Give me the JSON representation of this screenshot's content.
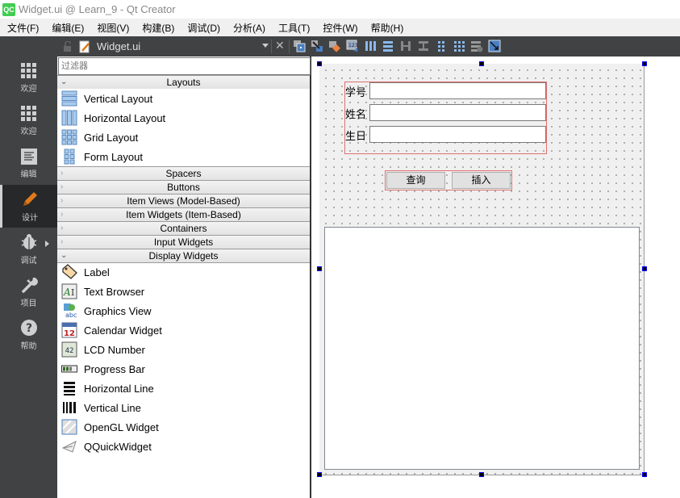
{
  "window": {
    "logo": "QC",
    "title": "Widget.ui @ Learn_9 - Qt Creator"
  },
  "menu": [
    "文件(F)",
    "编辑(E)",
    "视图(V)",
    "构建(B)",
    "调试(D)",
    "分析(A)",
    "工具(T)",
    "控件(W)",
    "帮助(H)"
  ],
  "toolbar": {
    "document": "Widget.ui",
    "close_glyph": "✕"
  },
  "modes": [
    {
      "label": "欢迎",
      "icon": "grid-icon"
    },
    {
      "label": "欢迎",
      "icon": "grid-icon"
    },
    {
      "label": "编辑",
      "icon": "edit-document-icon"
    },
    {
      "label": "设计",
      "icon": "pencil-icon",
      "active": true
    },
    {
      "label": "调试",
      "icon": "bug-icon"
    },
    {
      "label": "项目",
      "icon": "wrench-icon"
    },
    {
      "label": "帮助",
      "icon": "help-icon"
    }
  ],
  "widgetbox": {
    "filter_placeholder": "过滤器",
    "categories": {
      "layouts": "Layouts",
      "spacers": "Spacers",
      "buttons": "Buttons",
      "item_views": "Item Views (Model-Based)",
      "item_widgets": "Item Widgets (Item-Based)",
      "containers": "Containers",
      "input_widgets": "Input Widgets",
      "display_widgets": "Display Widgets"
    },
    "layouts": [
      "Vertical Layout",
      "Horizontal Layout",
      "Grid Layout",
      "Form Layout"
    ],
    "display_widgets": [
      "Label",
      "Text Browser",
      "Graphics View",
      "Calendar Widget",
      "LCD Number",
      "Progress Bar",
      "Horizontal Line",
      "Vertical Line",
      "OpenGL Widget",
      "QQuickWidget"
    ]
  },
  "form": {
    "labels": [
      "学号",
      "姓名",
      "生日"
    ],
    "values": [
      "",
      "",
      ""
    ],
    "buttons": [
      "查询",
      "插入"
    ],
    "text_area": ""
  }
}
